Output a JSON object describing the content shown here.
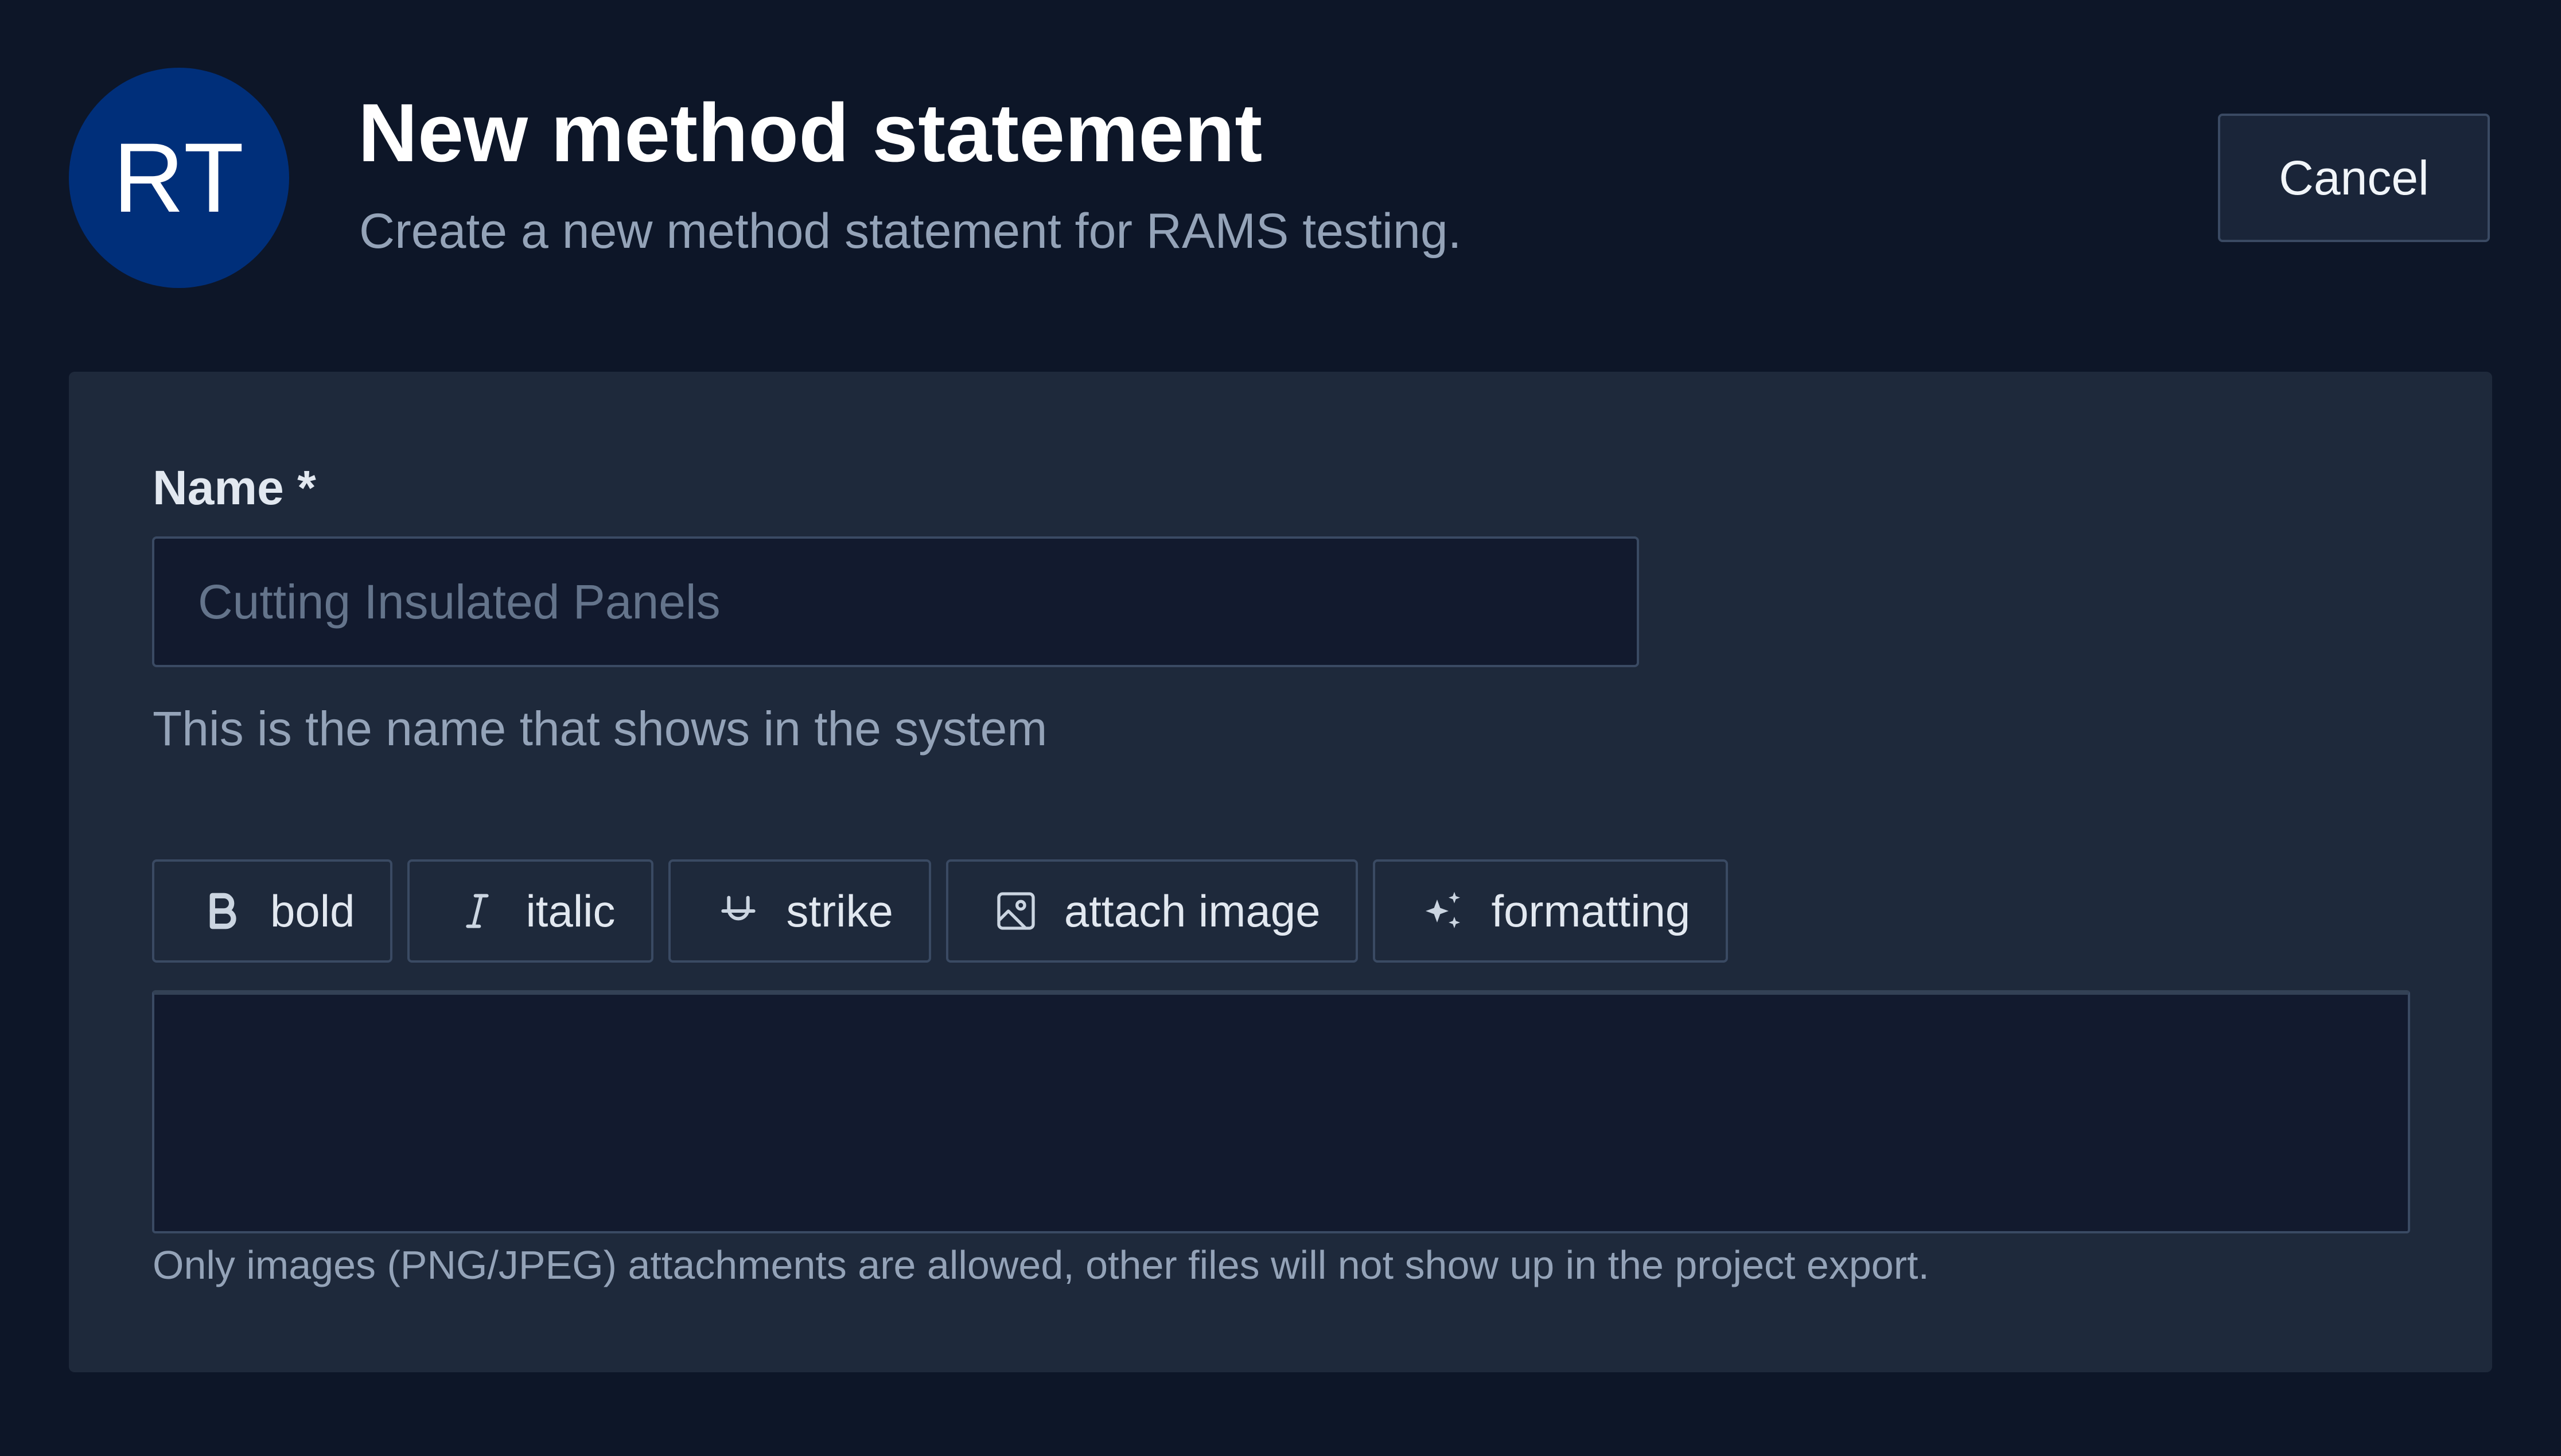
{
  "header": {
    "avatar_initials": "RT",
    "title": "New method statement",
    "subtitle": "Create a new method statement for RAMS testing.",
    "cancel_label": "Cancel"
  },
  "form": {
    "name_label": "Name *",
    "name_placeholder": "Cutting Insulated Panels",
    "name_value": "",
    "name_help": "This is the name that shows in the system",
    "toolbar": [
      {
        "label": "bold",
        "icon": "bold-icon"
      },
      {
        "label": "italic",
        "icon": "italic-icon"
      },
      {
        "label": "strike",
        "icon": "strikethrough-icon"
      },
      {
        "label": "attach image",
        "icon": "image-icon"
      },
      {
        "label": "formatting",
        "icon": "sparkles-icon"
      }
    ],
    "editor_value": "",
    "attachment_note": "Only images (PNG/JPEG) attachments are allowed, other files will not show up in the project export."
  },
  "colors": {
    "background": "#0d1628",
    "card": "#1e293b",
    "avatar": "#002f7a",
    "input": "#121a2e",
    "border": "#3a4a63"
  }
}
